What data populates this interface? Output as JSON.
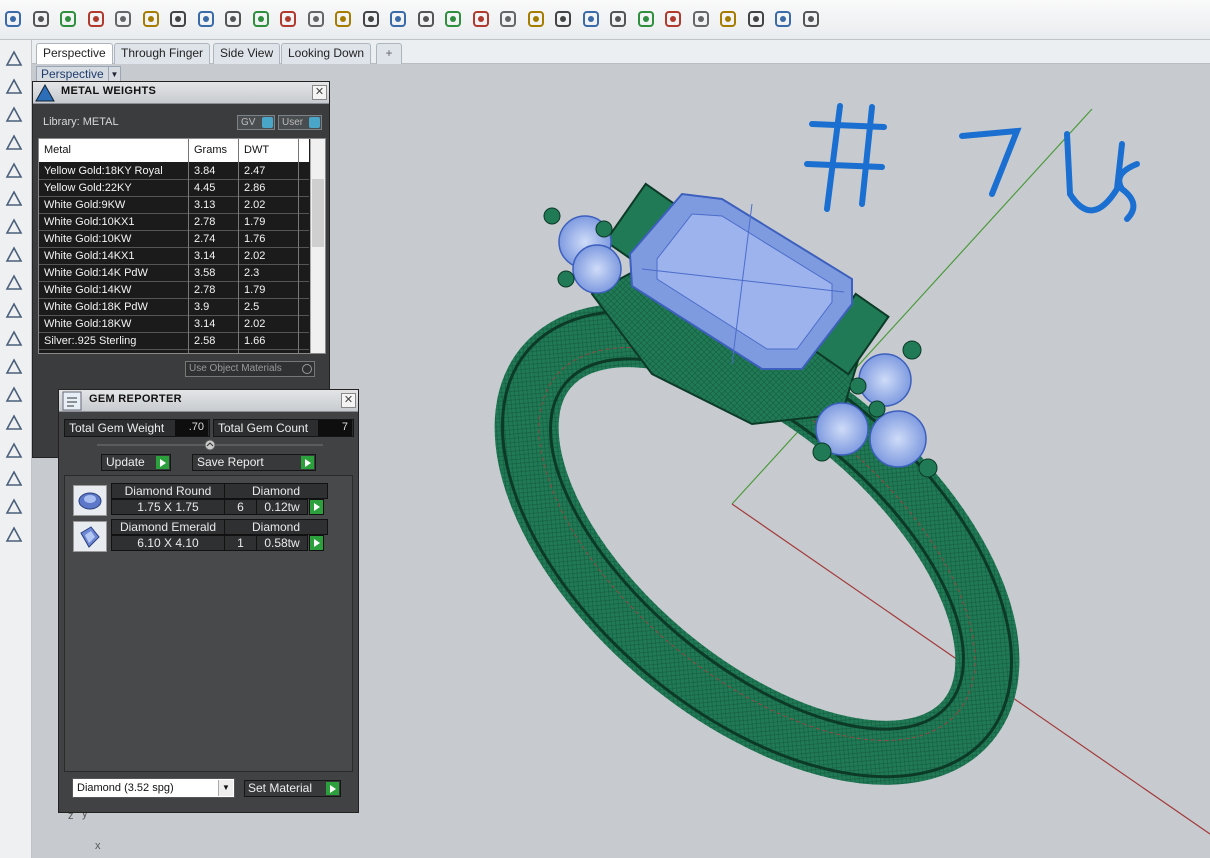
{
  "toolbar": {
    "icons": [
      "save-icon",
      "print-icon",
      "paste-special-icon",
      "cut-icon",
      "copy-icon",
      "clipboard-icon",
      "undo-icon",
      "pan-icon",
      "rotate-view-icon",
      "zoom-icon",
      "zoom-window-icon",
      "zoom-extents-icon",
      "zoom-selected-icon",
      "undo-view-icon",
      "four-viewports-icon",
      "car-icon",
      "object-properties-icon",
      "point-icon",
      "transform-icon",
      "light-icon",
      "lock-icon",
      "layers-icon",
      "color-wheel-icon",
      "shade-icon",
      "render-icon",
      "render-blue-icon",
      "pointer-icon",
      "settings-icon",
      "grid-snap-icon",
      "help-icon"
    ]
  },
  "viewport_tabs": [
    {
      "label": "Perspective",
      "active": true
    },
    {
      "label": "Through Finger",
      "active": false
    },
    {
      "label": "Side View",
      "active": false
    },
    {
      "label": "Looking Down",
      "active": false
    }
  ],
  "viewport": {
    "label": "Perspective",
    "handwriting": "# 7 US",
    "axis": {
      "z": "z",
      "y": "y",
      "x": "x"
    }
  },
  "metal_panel": {
    "title": "METAL WEIGHTS",
    "library_label": "Library: METAL",
    "toggle_gv": "GV",
    "toggle_user": "User",
    "columns": [
      "Metal",
      "Grams",
      "DWT"
    ],
    "rows": [
      {
        "metal": "Yellow Gold:18KY Royal",
        "grams": "3.84",
        "dwt": "2.47"
      },
      {
        "metal": "Yellow Gold:22KY",
        "grams": "4.45",
        "dwt": "2.86"
      },
      {
        "metal": "White Gold:9KW",
        "grams": "3.13",
        "dwt": "2.02"
      },
      {
        "metal": "White Gold:10KX1",
        "grams": "2.78",
        "dwt": "1.79"
      },
      {
        "metal": "White Gold:10KW",
        "grams": "2.74",
        "dwt": "1.76"
      },
      {
        "metal": "White Gold:14KX1",
        "grams": "3.14",
        "dwt": "2.02"
      },
      {
        "metal": "White Gold:14K PdW",
        "grams": "3.58",
        "dwt": "2.3"
      },
      {
        "metal": "White Gold:14KW",
        "grams": "2.78",
        "dwt": "1.79"
      },
      {
        "metal": "White Gold:18K PdW",
        "grams": "3.9",
        "dwt": "2.5"
      },
      {
        "metal": "White Gold:18KW",
        "grams": "3.14",
        "dwt": "2.02"
      },
      {
        "metal": "Silver:.925 Sterling",
        "grams": "2.58",
        "dwt": "1.66"
      }
    ],
    "use_object_materials": "Use Object Materials"
  },
  "gem_panel": {
    "title": "GEM REPORTER",
    "total_weight_label": "Total Gem Weight",
    "total_weight_value": ".70",
    "total_count_label": "Total Gem Count",
    "total_count_value": "7",
    "update_label": "Update",
    "save_report_label": "Save Report",
    "gems": [
      {
        "shape": "Diamond Round",
        "material": "Diamond",
        "size": "1.75 X 1.75",
        "count": "6",
        "weight": "0.12tw"
      },
      {
        "shape": "Diamond Emerald",
        "material": "Diamond",
        "size": "6.10 X 4.10",
        "count": "1",
        "weight": "0.58tw"
      }
    ],
    "material_select": "Diamond     (3.52 spg)",
    "set_material_label": "Set Material"
  },
  "colors": {
    "ring_green": "#1f7a55",
    "gem_blue": "#8aa6e8",
    "handwriting_blue": "#1a6fd0",
    "axis_red": "#a33a3a",
    "axis_green": "#4c9a3a",
    "go_green": "#2ca03c"
  }
}
